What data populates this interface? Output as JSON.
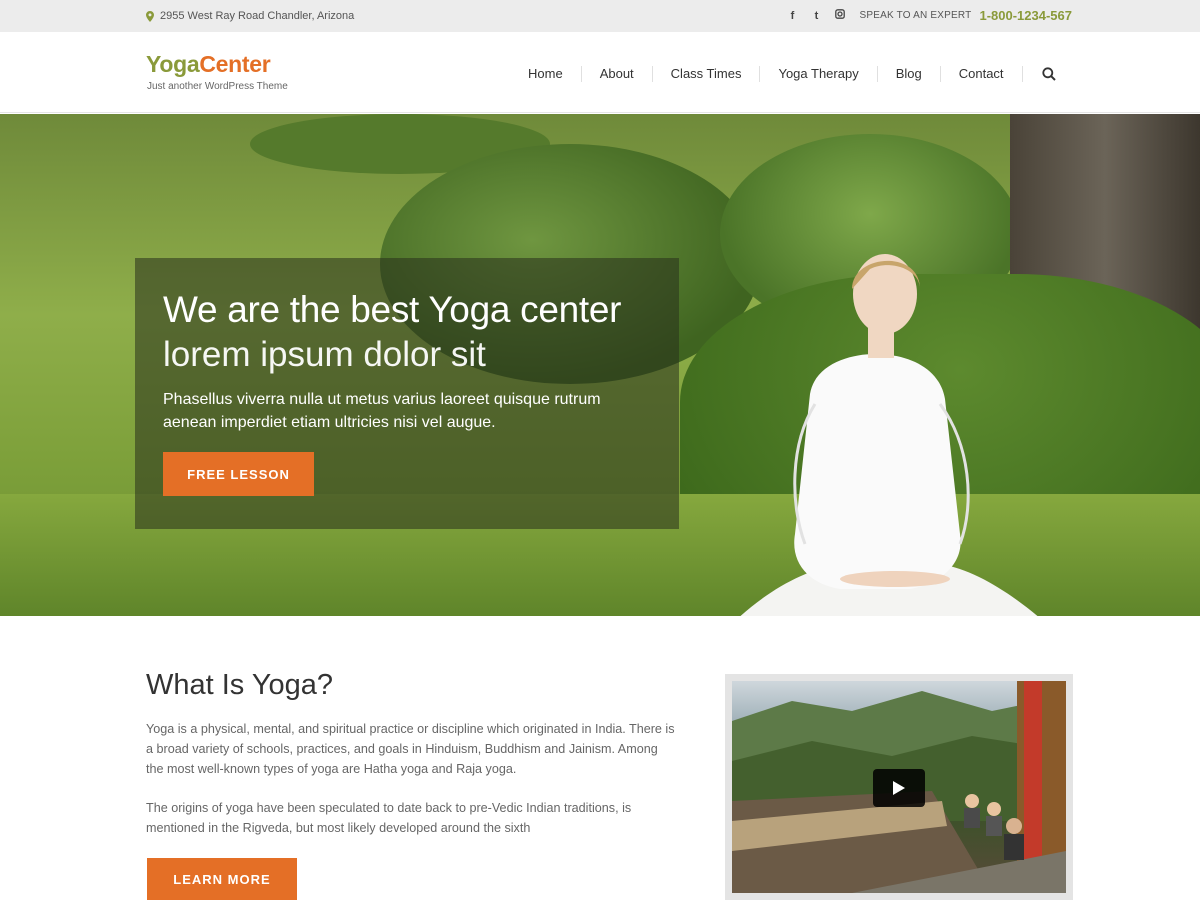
{
  "topbar": {
    "address": "2955 West Ray Road Chandler, Arizona",
    "social": [
      "f",
      "t",
      "ig"
    ],
    "speak_label": "SPEAK TO AN EXPERT",
    "phone": "1-800-1234-567"
  },
  "header": {
    "logo_yoga": "Yoga",
    "logo_center": "Center",
    "tagline": "Just another WordPress Theme",
    "nav": [
      "Home",
      "About",
      "Class Times",
      "Yoga Therapy",
      "Blog",
      "Contact"
    ]
  },
  "hero": {
    "title": "We are the best Yoga center",
    "subtitle": "lorem ipsum dolor sit",
    "text": "Phasellus viverra nulla ut metus varius laoreet quisque rutrum aenean imperdiet etiam ultricies nisi vel augue.",
    "button": "FREE LESSON"
  },
  "about": {
    "title": "What Is Yoga?",
    "paragraph1": "Yoga is a physical, mental, and spiritual practice or discipline which originated in India. There is a broad variety of schools, practices, and goals in Hinduism, Buddhism and Jainism. Among the most well-known types of yoga are Hatha yoga and Raja yoga.",
    "paragraph2": "The origins of yoga have been speculated to date back to pre-Vedic Indian traditions, is mentioned in the Rigveda, but most likely developed around the sixth",
    "button": "LEARN MORE"
  },
  "colors": {
    "accent": "#e46f26",
    "brand_green": "#8a9a3a"
  }
}
